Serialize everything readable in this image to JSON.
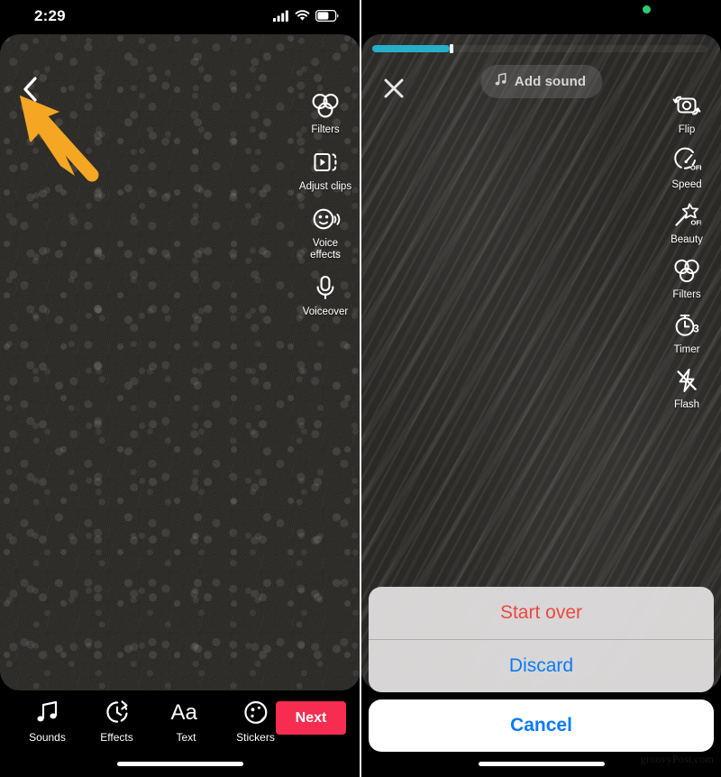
{
  "colors": {
    "accent_red": "#f72c51",
    "progress_cyan": "#27aec9",
    "destructive_red": "#ea4a42",
    "ios_blue": "#0a7bf7",
    "annotation_orange": "#f5a623",
    "recording_green": "#2ecc71",
    "video_dark": "#2c2a27"
  },
  "left_phone": {
    "status_bar": {
      "time": "2:29",
      "icons": [
        "cellular-signal-icon",
        "wifi-icon",
        "battery-icon"
      ]
    },
    "back_button": {
      "icon": "chevron-left-icon",
      "label": "Back"
    },
    "tools": [
      {
        "icon": "filters-icon",
        "label": "Filters"
      },
      {
        "icon": "adjust-clips-icon",
        "label": "Adjust clips"
      },
      {
        "icon": "voice-effects-icon",
        "label": "Voice\neffects"
      },
      {
        "icon": "voiceover-icon",
        "label": "Voiceover"
      }
    ],
    "bottom_bar": {
      "tools": [
        {
          "icon": "music-note-icon",
          "label": "Sounds"
        },
        {
          "icon": "effects-icon",
          "label": "Effects"
        },
        {
          "icon": "text-aa-icon",
          "label": "Text"
        },
        {
          "icon": "stickers-icon",
          "label": "Stickers"
        }
      ],
      "next_label": "Next"
    },
    "annotation": {
      "arrow": "annotation-arrow-pointing-up-left",
      "target": "back-button"
    }
  },
  "right_phone": {
    "status_bar": {
      "recording_indicator": "green-dot-icon"
    },
    "progress": {
      "percent": 23,
      "label": "recording-progress"
    },
    "close_button": {
      "icon": "close-x-icon",
      "label": "Close"
    },
    "add_sound": {
      "icon": "music-note-icon",
      "label": "Add sound"
    },
    "tools": [
      {
        "icon": "flip-camera-icon",
        "label": "Flip",
        "badge": ""
      },
      {
        "icon": "speed-icon",
        "label": "Speed",
        "badge": "OFF"
      },
      {
        "icon": "beauty-wand-icon",
        "label": "Beauty",
        "badge": "OFF"
      },
      {
        "icon": "filters-icon",
        "label": "Filters",
        "badge": ""
      },
      {
        "icon": "timer-icon",
        "label": "Timer",
        "badge": "3"
      },
      {
        "icon": "flash-off-icon",
        "label": "Flash",
        "badge": ""
      }
    ],
    "action_sheet": {
      "items": [
        {
          "label": "Start over",
          "style": "destructive"
        },
        {
          "label": "Discard",
          "style": "normal"
        }
      ],
      "cancel_label": "Cancel"
    },
    "annotation": {
      "arrow": "annotation-arrow-pointing-up-left",
      "target": "close-button"
    }
  },
  "watermark": {
    "text": "groovyPost.com"
  }
}
